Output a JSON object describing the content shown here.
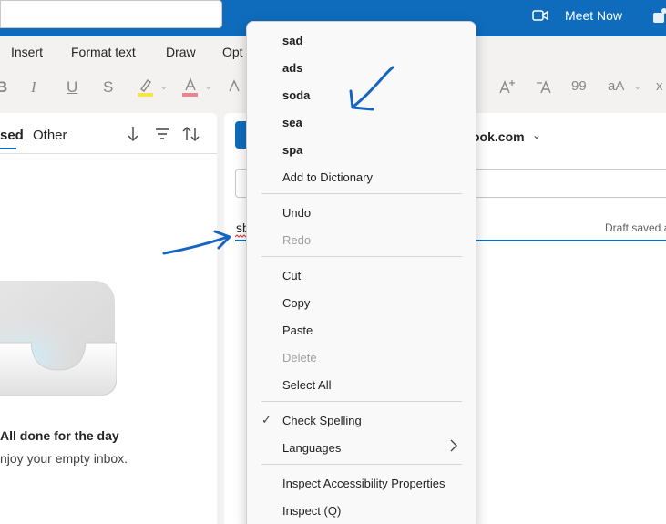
{
  "titlebar": {
    "meet_now_label": "Meet Now",
    "video_icon": "video-camera-icon",
    "teams_icon": "teams-icon"
  },
  "ribbon": {
    "tabs": [
      "Insert",
      "Format text",
      "Draw",
      "Opt"
    ]
  },
  "toolbar": {
    "bold": "B",
    "italic": "I",
    "underline": "U",
    "strikethrough": "S",
    "quote": "99",
    "change_case": "aA",
    "superscript": "x"
  },
  "inbox": {
    "focused_tab": "sed",
    "other_tab": "Other",
    "empty_title": "All done for the day",
    "empty_subtitle": "njoy your empty inbox.",
    "icons": [
      "arrow-down-icon",
      "filter-icon",
      "sort-icon"
    ]
  },
  "compose": {
    "from_text": "ook.com",
    "draft_saved": "Draft saved a",
    "typed_word": "sb"
  },
  "context_menu": {
    "suggestions": [
      "sad",
      "ads",
      "soda",
      "sea",
      "spa"
    ],
    "add_to_dictionary": "Add to Dictionary",
    "undo": "Undo",
    "redo": "Redo",
    "cut": "Cut",
    "copy": "Copy",
    "paste": "Paste",
    "delete": "Delete",
    "select_all": "Select All",
    "check_spelling": "Check Spelling",
    "languages": "Languages",
    "inspect_accessibility": "Inspect Accessibility Properties",
    "inspect": "Inspect (Q)"
  },
  "colors": {
    "brand": "#0f6cbd",
    "annotation": "#1565c0",
    "highlight_yellow": "#f7e44a",
    "font_color_red": "#e8868c"
  }
}
